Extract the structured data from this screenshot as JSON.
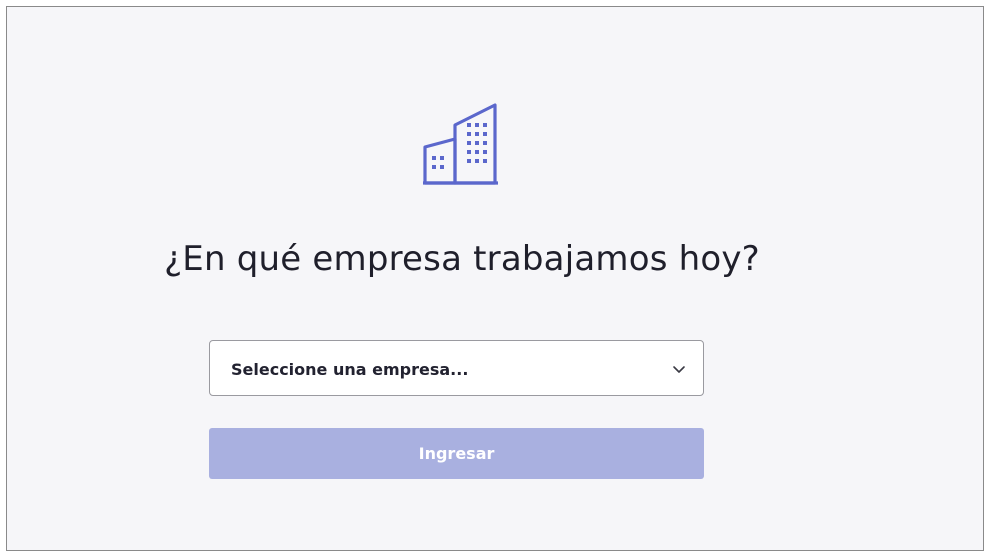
{
  "icon": {
    "name": "building-icon",
    "color": "#5b67cc"
  },
  "heading": "¿En qué empresa trabajamos hoy?",
  "company_select": {
    "placeholder": "Seleccione una empresa...",
    "selected_value": "Seleccione una empresa...",
    "icon": "chevron-down-icon"
  },
  "submit_button": {
    "label": "Ingresar",
    "disabled": true,
    "color": "#a9b0e0"
  }
}
